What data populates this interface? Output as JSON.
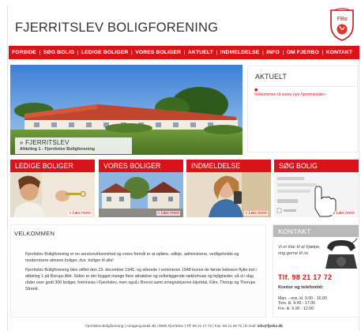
{
  "header": {
    "site_title": "FJERRITSLEV BOLIGFORENING",
    "logo_text": "FBo"
  },
  "nav": {
    "items": [
      {
        "label": "FORSIDE"
      },
      {
        "label": "SØG BOLIG"
      },
      {
        "label": "LEDIGE BOLIGER"
      },
      {
        "label": "VORES BOLIGER"
      },
      {
        "label": "AKTUELT"
      },
      {
        "label": "INDMELDELSE"
      },
      {
        "label": "INFO"
      },
      {
        "label": "OM FJERBO"
      },
      {
        "label": "KONTAKT"
      }
    ],
    "separator": "|"
  },
  "hero": {
    "title": "» FJERRITSLEV",
    "subtitle": "Afdeling 1 - Fjerritslev Boligforening"
  },
  "aktuelt": {
    "title": "AKTUELT",
    "news_item": "Velkommen til vores nye hjemmeside»"
  },
  "boxes": [
    {
      "title": "LEDIGE BOLIGER",
      "more": "» Læs mere"
    },
    {
      "title": "VORES BOLIGER",
      "more": "» Læs mere"
    },
    {
      "title": "INDMELDELSE",
      "more": "» Læs mere"
    },
    {
      "title": "SØG BOLIG",
      "more": "» Læs mere"
    }
  ],
  "welcome": {
    "title": "VELKOMMEN",
    "paragraph1": "Fjerritslev Boligforening er en servicevirksomhed og vores formål er at opføre, udleje, administrere, vedligeholde og modernisere almene boliger, dvs. boliger til alle!",
    "paragraph2": "Fjerritslev Boligforening blev stiftet den 19. december 1945, og allerede i sommeren 1948 kunne de første beboere flytte ind i afdeling 1 på Borups Allé. Siden er der bygget mange flere attraktive og velbeliggende rækkehuse og lejligheder, så vi i dag råder over godt 300 boliger, fortrinsvis i Fjerritslev, men også i Brovst samt omegnsbyerne Hjortdal, Klim, Thorup og Thorups Strand."
  },
  "kontakt": {
    "title": "KONTAKT",
    "text": "Vi er klar til at hjælpe, ring gerne til os",
    "phone": "Tlf. 98 21 17 72",
    "hours_title": "Kontor og telefontid:",
    "hours": [
      "Man. - ons. kl. 9.00 - 16.00",
      "Tors. kl. 9.00 - 17.00",
      "Fre. kl. 9.00 - 12.00"
    ]
  },
  "footer": {
    "text": "Fjerritslev Boligforening | Amagerqvindel 4B | 9690 Fjerritslev | Tlf: 98 21 17 72 | Fax: 98 21 28 72 | E-mail: ",
    "email": "info@fjerbo.dk"
  },
  "colors": {
    "accent_red": "#d8141a",
    "kontakt_bar_gray": "#b9b9b9"
  }
}
